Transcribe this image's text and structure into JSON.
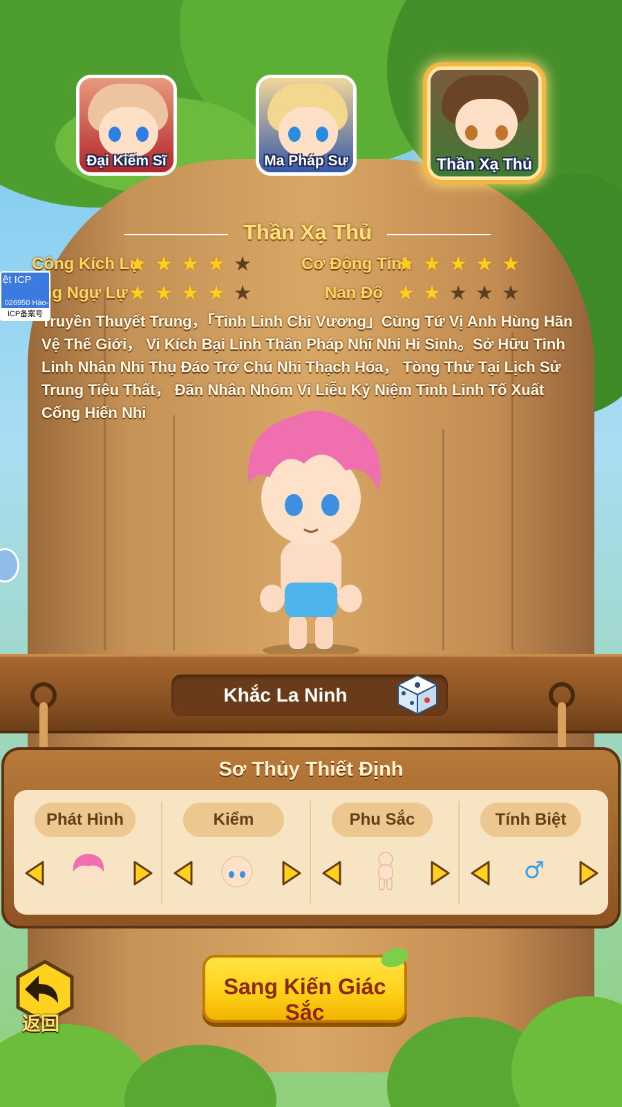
{
  "jobs": [
    {
      "label": "Đại Kiếm Sĩ",
      "selected": false
    },
    {
      "label": "Ma Pháp Sư",
      "selected": false
    },
    {
      "label": "Thần Xạ Thủ",
      "selected": true
    }
  ],
  "class_title": "Thần Xạ Thủ",
  "stats": [
    {
      "label": "Cộng Kích Lự",
      "stars": 4,
      "max": 5
    },
    {
      "label": "Cơ Động Tính",
      "stars": 5,
      "max": 5
    },
    {
      "label": "ọng Ngự Lự",
      "stars": 4,
      "max": 5
    },
    {
      "label": "Nan Độ",
      "stars": 2,
      "max": 5
    }
  ],
  "description": "Truyền Thuyết Trung，「Tinh Linh Chi Vương」Cùng Tứ Vị Anh Hùng Hãn Vệ Thế Giới， Vi Kích Bại Linh Thần Pháp Nhĩ Nhi Hi Sinh。Sở Hữu Tinh Linh Nhân Nhi Thụ Đáo Trớ Chú Nhi Thạch Hóa， Tòng Thử Tại Lịch Sử Trung Tiêu Thất， Đãn Nhân Nhóm Vi Liễu Kỷ Niệm Tinh Linh Tố Xuất Cống Hiến Nhi",
  "icp": {
    "top": "ệt ICP",
    "number": "026950 Hào-",
    "bottom": "ICP备案号"
  },
  "character_name": "Khắc La Ninh",
  "settings": {
    "title": "Sơ Thủy Thiết Định",
    "options": [
      {
        "label": "Phát Hình",
        "icon": "pink-hair-icon"
      },
      {
        "label": "Kiểm",
        "icon": "face-icon"
      },
      {
        "label": "Phu Sắc",
        "icon": "body-skin-icon"
      },
      {
        "label": "Tính Biệt",
        "icon": "male-symbol-icon",
        "value": "♂"
      }
    ]
  },
  "start_button": "Sang Kiến Giác Sắc",
  "back_button": "返回",
  "colors": {
    "star_on": "#ffcf1f",
    "star_off": "#5a4022",
    "title": "#ffe07a",
    "button": "#ffd11a"
  }
}
